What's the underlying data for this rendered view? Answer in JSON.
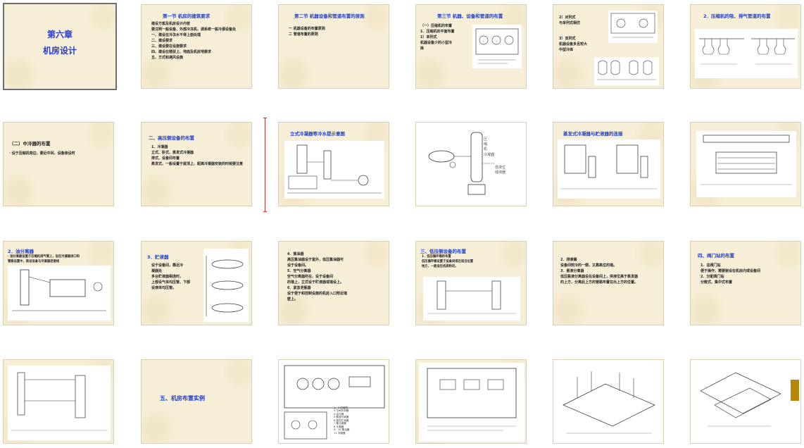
{
  "slides": [
    {
      "id": 1,
      "title_lines": [
        "第六章",
        "机房设计"
      ]
    },
    {
      "id": 2,
      "title": "第一节 机房的建筑要求",
      "body": "建设方案及机房设计内容\n要注明一般设备、外部冷冻机、调系统一般冷源设备处\n一、建设在冷冻水不得上面处理\n二、建设要求\n三、建设要在设施要求\n四、建设在楼层上、地面及机房地要求\n五、方式和通风设施"
    },
    {
      "id": 3,
      "title": "第二节 机器设备和管道布置的原则",
      "body": "一  机器设备的布置原则\n二  管道布置的原则"
    },
    {
      "id": 4,
      "title": "第三节    机器、设备和管道的布置",
      "body": "（一）压缩机的布置\n1．压缩机的平面布置\n1）单列式\n    机器设备少的小型冷\n库"
    },
    {
      "id": 5,
      "body_top": "2）对列式\n   与单列式相仿",
      "body_mid": "3）双列式\n机器设备多且较大\n中型冷库"
    },
    {
      "id": 6,
      "title": "2．压缩机的吸、排气管道的布置"
    },
    {
      "id": 7,
      "title": "（二）中冷器的布置",
      "body": "·  设于压缩机旁边，要近中间、设备装设时"
    },
    {
      "id": 8,
      "title": "二、高压侧设备的布置",
      "body": "1．冷凝器\n立式、卧式、蒸发式冷凝器\n排式、设备间布置\n蒸发式，一般设置于屋顶上、配高冷凝器安装的时候要注意"
    },
    {
      "id": 9,
      "title": "立式冷凝器等冷水提示意图"
    },
    {
      "id": 10,
      "labels": [
        "压",
        "缩",
        "机",
        "冷凝器",
        "低液位",
        "储液器"
      ]
    },
    {
      "id": 11,
      "title": "蒸发式冷凝器与贮液器的连接"
    },
    {
      "id": 12
    },
    {
      "id": 13,
      "title": "2．油分离器",
      "body": "·  油分离器设置于压缩机排气管上，设在冷凝器进口和\n    管路设置中，装设设备与冷凝器连接线"
    },
    {
      "id": 14,
      "title": "3．贮液器",
      "body": "设于设备间，靠近冷\n凝器处\n多台贮液器相连时，\n上部设气体均压管、下部\n设液体均压管。"
    },
    {
      "id": 15,
      "body": "4．集油器\n    高压集油器设于室外，低压集油器可\n设于设备间。\n5．空气分离器\n    空气分离器所在，设于设备间\n的墙上，立式设于贮液器或墙设上。\n6．紧急泄氨器\n    设于便于和控制设施的机房入口附近墙\n壁上。"
    },
    {
      "id": 16,
      "title": "三、低压侧设备的布置",
      "body": "1．低压循环桶的布置\n    低压循环桶设置于设备间或在适当位置\n    地方，一般设在机房附近。"
    },
    {
      "id": 17,
      "body": "2．排液桶\n    设备间较冷的一侧，又靠高位的墙。\n3．氨液分离器\n    低压氨液分离器设在设备间上，供液位高于蒸发器\n的上方，分离后上方的管路布置在出上方的位置。"
    },
    {
      "id": 18,
      "title": "四、阀门站的布置",
      "body": "1．总阀门站\n    便于操作，需要装设在机房内或设备间\n2．分配阀门站\n    分散式、集中式布置"
    },
    {
      "id": 19
    },
    {
      "id": 20,
      "title": "五、机房布置实例"
    },
    {
      "id": 21,
      "legend": [
        "1、2 压缩机",
        "3 中间冷却器",
        "4 油分器",
        "5 氨液分离器",
        "6 高压贮液器",
        "7 集分离器",
        "8 冷凝器",
        "9、10 集油器",
        "11 冷凝器"
      ]
    },
    {
      "id": 22
    },
    {
      "id": 23
    },
    {
      "id": 24
    }
  ],
  "colors": {
    "slide_bg": "#f7eed7",
    "title_blue": "#1f3fc8",
    "accent_red": "#c0392b"
  }
}
